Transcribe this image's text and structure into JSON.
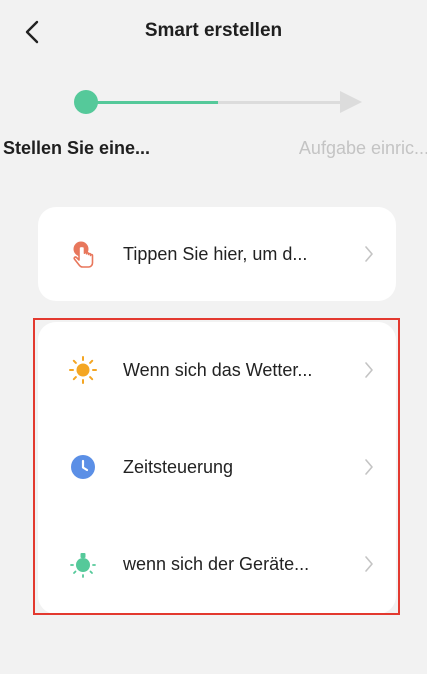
{
  "header": {
    "title": "Smart erstellen"
  },
  "stepper": {
    "steps": [
      {
        "label": "Stellen Sie eine..."
      },
      {
        "label": "Aufgabe einric..."
      }
    ]
  },
  "tap_card": {
    "label": "Tippen Sie hier, um d...",
    "icon": "tap-hand-icon",
    "icon_color": "#e8775c"
  },
  "conditions": {
    "items": [
      {
        "label": "Wenn sich das Wetter...",
        "icon": "sun-icon",
        "color": "#f4a623"
      },
      {
        "label": "Zeitsteuerung",
        "icon": "clock-icon",
        "color": "#5b8fe6"
      },
      {
        "label": "wenn sich der Geräte...",
        "icon": "device-status-icon",
        "color": "#55c99a"
      }
    ]
  },
  "colors": {
    "accent": "#55c99a",
    "highlight": "#e3392f"
  }
}
